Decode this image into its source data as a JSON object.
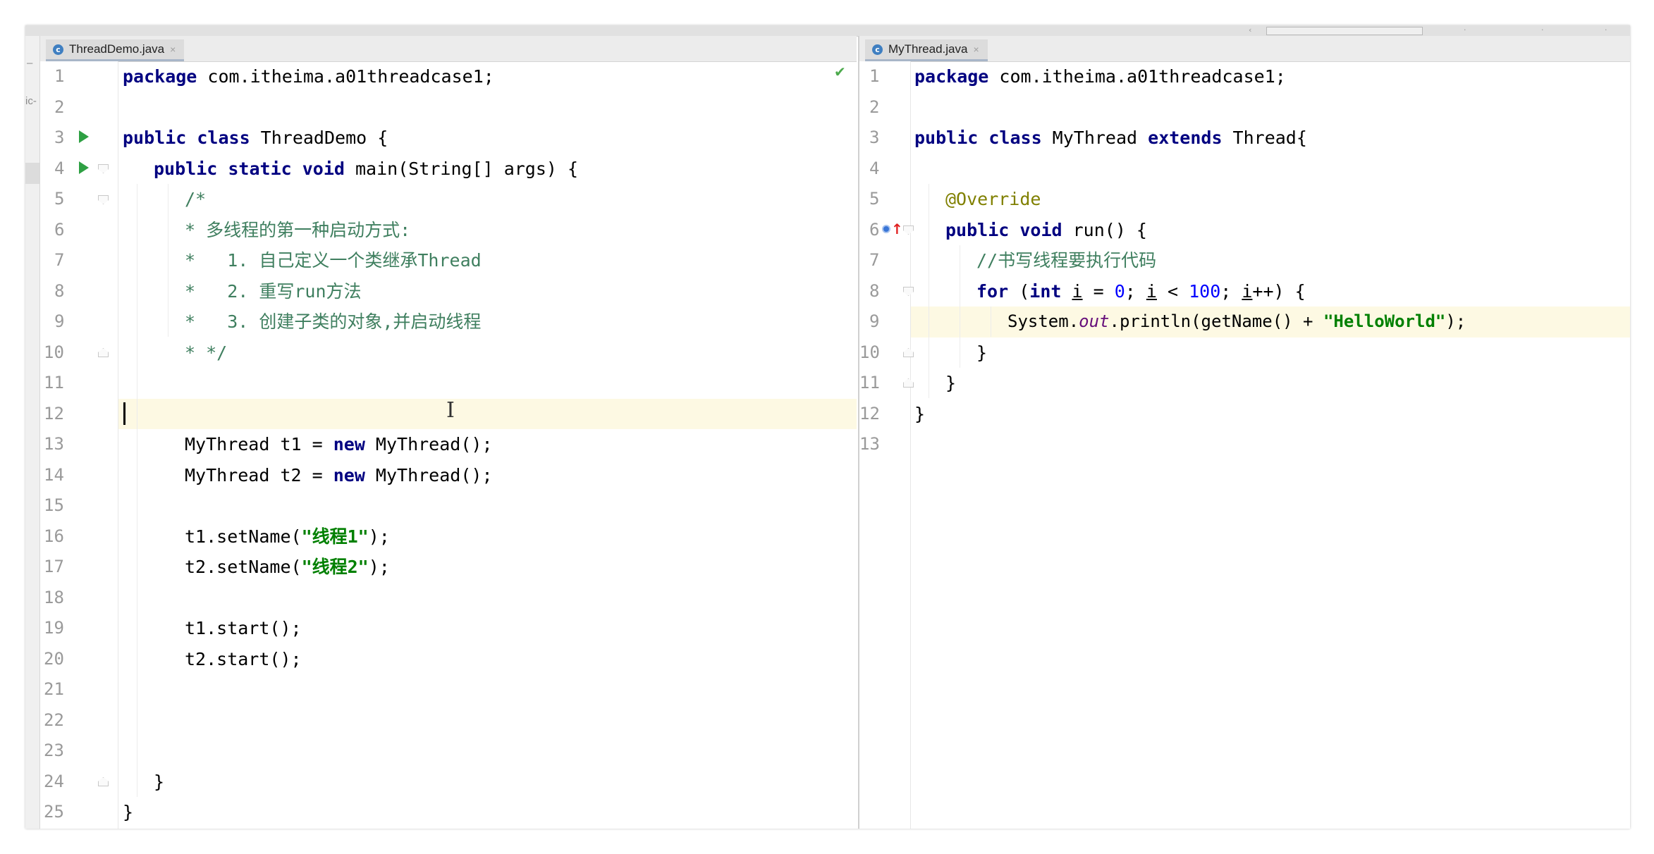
{
  "colors": {
    "keyword": "#000080",
    "comment": "#3f7f5f",
    "string": "#008000",
    "number": "#0000ff",
    "annotation": "#808000",
    "static_field": "#660e7a",
    "active_line": "#fdf9e3",
    "line_number": "#9a9a9a",
    "run_icon": "#2ea043"
  },
  "left_strip": {
    "label_a": "–",
    "label_b": "ic-"
  },
  "left_editor": {
    "tab": {
      "icon_letter": "c",
      "label": "ThreadDemo.java",
      "close": "×"
    },
    "line_numbers": [
      "1",
      "2",
      "3",
      "4",
      "5",
      "6",
      "7",
      "8",
      "9",
      "10",
      "11",
      "12",
      "13",
      "14",
      "15",
      "16",
      "17",
      "18",
      "19",
      "20",
      "21",
      "22",
      "23",
      "24",
      "25"
    ],
    "code": {
      "l1_kw": "package",
      "l1_rest": " com.itheima.a01threadcase1;",
      "l3_kw": "public class",
      "l3_rest": " ThreadDemo {",
      "l4_kw": "public static void",
      "l4_rest": " main(String[] args) {",
      "l5": "/*",
      "l6_star": "* ",
      "l6_text": "多线程的第一种启动方式:",
      "l7_star": "*   1. ",
      "l7_text": "自己定义一个类继承",
      "l7_code": "Thread",
      "l8_star": "*   2. ",
      "l8_text": "重写",
      "l8_code": "run",
      "l8_text2": "方法",
      "l9_star": "*   3. ",
      "l9_text": "创建子类的对象,并启动线程",
      "l10": "* */",
      "l13_a": "MyThread t1 = ",
      "l13_kw": "new",
      "l13_b": " MyThread();",
      "l14_a": "MyThread t2 = ",
      "l14_kw": "new",
      "l14_b": " MyThread();",
      "l16_a": "t1.setName(",
      "l16_str": "\"线程1\"",
      "l16_b": ");",
      "l17_a": "t2.setName(",
      "l17_str": "\"线程2\"",
      "l17_b": ");",
      "l19": "t1.start();",
      "l20": "t2.start();",
      "l24": "}",
      "l25": "}"
    }
  },
  "right_editor": {
    "tab": {
      "icon_letter": "c",
      "label": "MyThread.java",
      "close": "×"
    },
    "line_numbers": [
      "1",
      "2",
      "3",
      "4",
      "5",
      "6",
      "7",
      "8",
      "9",
      "10",
      "11",
      "12",
      "13"
    ],
    "code": {
      "l1_kw": "package",
      "l1_rest": " com.itheima.a01threadcase1;",
      "l3_kw1": "public class",
      "l3_mid": " MyThread ",
      "l3_kw2": "extends",
      "l3_rest": " Thread{",
      "l5": "@Override",
      "l6_kw": "public void",
      "l6_rest": " run() {",
      "l7": "//书写线程要执行代码",
      "l8_kw": "for",
      "l8_a": " (",
      "l8_kw2": "int",
      "l8_sp": " ",
      "l8_i1": "i",
      "l8_b": " = ",
      "l8_n0": "0",
      "l8_c": "; ",
      "l8_i2": "i",
      "l8_d": " < ",
      "l8_n100": "100",
      "l8_e": "; ",
      "l8_i3": "i",
      "l8_f": "++) {",
      "l9_a": "System.",
      "l9_out": "out",
      "l9_b": ".println(getName() + ",
      "l9_str": "\"HelloWorld\"",
      "l9_c": ");",
      "l10": "}",
      "l11": "}",
      "l12": "}"
    }
  }
}
